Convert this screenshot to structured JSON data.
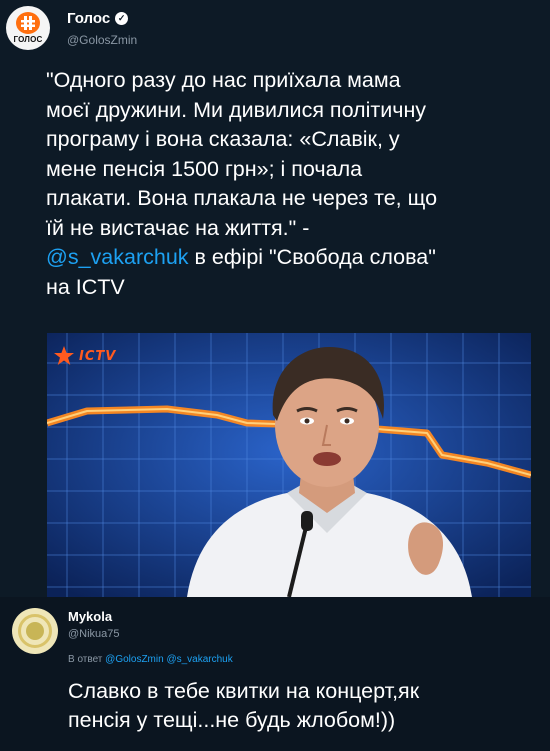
{
  "tweet": {
    "author_name": "Голос",
    "handle": "@GolosZmin",
    "avatar_word": "ГОЛОС",
    "text_before_mention": "\"Одного разу до нас приїхала мама\nмоєї дружини. Ми дивилися політичну\nпрограму і вона сказала: «Славік, у\nмене пенсія 1500 грн»; і почала\nплакати. Вона плакала не через те, що\nїй не вистачає на життя.\" -\n",
    "mention": "@s_vakarchuk",
    "text_after_mention": " в ефірі \"Свобода слова\"\nна ICTV",
    "photo": {
      "channel_logo": "ICTV",
      "accent_color": "#ff6f0f"
    }
  },
  "reply": {
    "author_name": "Mykola",
    "handle": "@Nikua75",
    "reply_prefix": "В ответ",
    "reply_mentions": "@GolosZmin @s_vakarchuk",
    "text": "Славко в тебе квитки на концерт,як\nпенсія у тещі...не будь жлобом!))"
  },
  "colors": {
    "background": "#0d1a26",
    "link": "#1da1f2",
    "secondary_text": "#8b98a5"
  },
  "icons": {
    "avatar1": "golos-logo-icon",
    "verified": "verified-badge-icon",
    "channel": "ictv-star-icon"
  }
}
